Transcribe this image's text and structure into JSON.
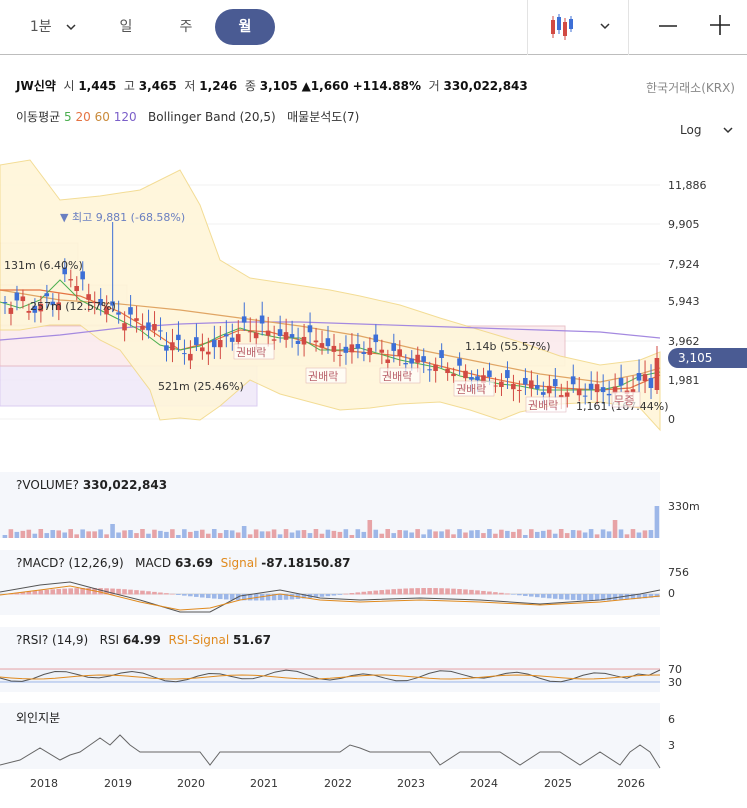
{
  "tabs": [
    {
      "label": "1분",
      "active": false
    },
    {
      "label": "일",
      "active": false
    },
    {
      "label": "주",
      "active": false
    },
    {
      "label": "월",
      "active": true
    }
  ],
  "stock": {
    "name": "JW신약",
    "open_label": "시",
    "open": "1,445",
    "high_label": "고",
    "high": "3,465",
    "low_label": "저",
    "low": "1,246",
    "close_label": "종",
    "close": "3,105",
    "change": "▲1,660",
    "change_pct": "+114.88%",
    "volume_label": "거",
    "volume": "330,022,843",
    "market": "한국거래소(KRX)"
  },
  "indicators": {
    "ma_label": "이동평균",
    "ma": [
      {
        "value": "5",
        "color": "#4caf50"
      },
      {
        "value": "20",
        "color": "#e57342"
      },
      {
        "value": "60",
        "color": "#c98a3a"
      },
      {
        "value": "120",
        "color": "#7b5fc9"
      }
    ],
    "bollinger": "Bollinger Band (20,5)",
    "volume_profile": "매물분석도(7)",
    "scale": "Log"
  },
  "price_axis": [
    "11,886",
    "9,905",
    "7,924",
    "5,943",
    "3,962",
    "1,981",
    "0"
  ],
  "current_price": "3,105",
  "annotations": {
    "high": "▼ 최고 9,881 (-68.58%)",
    "low": "1,161 (167.44%)",
    "vp": [
      "131m (6.40%)",
      "257m (12.57%)",
      "521m (25.46%)",
      "1.14b (55.57%)"
    ],
    "events": [
      "권배락",
      "권배락",
      "권배락",
      "권배락",
      "권배락",
      "무증"
    ]
  },
  "volume_panel": {
    "title": "?VOLUME?",
    "value": "330,022,843",
    "axis": "330m"
  },
  "macd_panel": {
    "title": "?MACD? (12,26,9)",
    "macd_label": "MACD",
    "macd_value": "63.69",
    "signal_label": "Signal",
    "signal_value": "-87.18150.87",
    "axis": [
      "756",
      "0"
    ]
  },
  "rsi_panel": {
    "title": "?RSI? (14,9)",
    "rsi_label": "RSI",
    "rsi_value": "64.99",
    "signal_label": "RSI-Signal",
    "signal_value": "51.67",
    "axis": [
      "70",
      "30"
    ]
  },
  "foreign_panel": {
    "title": "외인지분",
    "axis": [
      "6",
      "3"
    ]
  },
  "x_axis": [
    "2018",
    "2019",
    "2020",
    "2021",
    "2022",
    "2023",
    "2024",
    "2025",
    "2026"
  ],
  "colors": {
    "accent": "#4a5b93",
    "up": "#d24a43",
    "down": "#3d6fd6"
  }
}
